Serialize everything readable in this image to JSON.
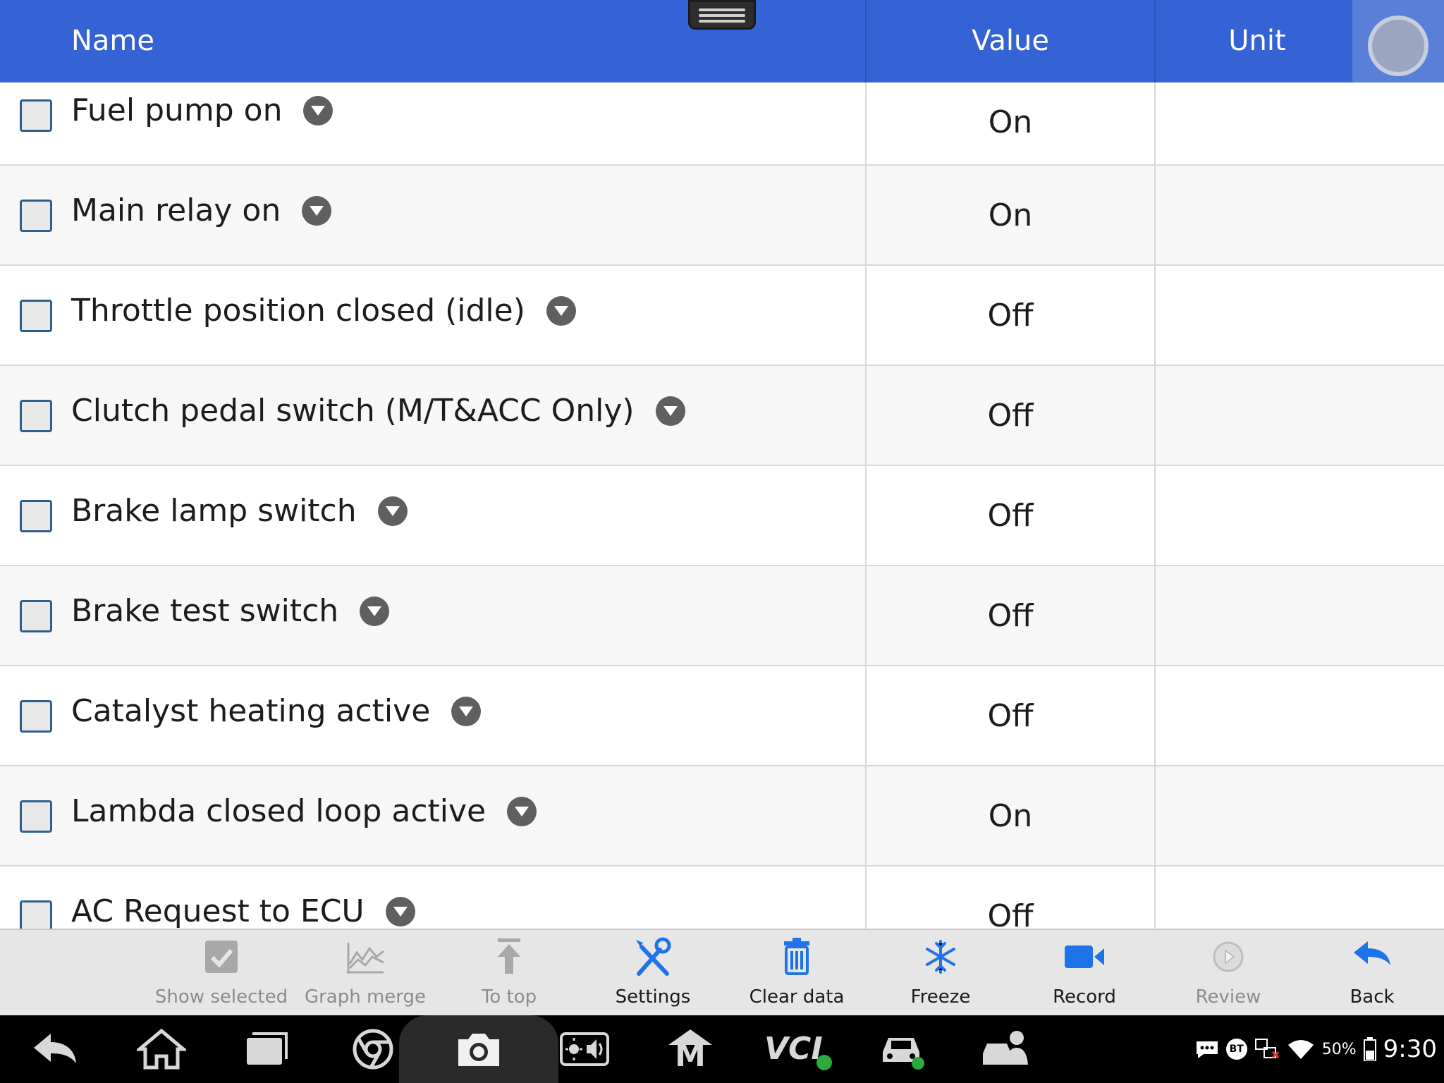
{
  "header": {
    "col_name": "Name",
    "col_value": "Value",
    "col_unit": "Unit"
  },
  "rows": [
    {
      "name": "Fuel pump on",
      "value": "On",
      "unit": ""
    },
    {
      "name": "Main relay on",
      "value": "On",
      "unit": ""
    },
    {
      "name": "Throttle position closed (idle)",
      "value": "Off",
      "unit": ""
    },
    {
      "name": "Clutch pedal switch (M/T&ACC Only)",
      "value": "Off",
      "unit": ""
    },
    {
      "name": "Brake lamp switch",
      "value": "Off",
      "unit": ""
    },
    {
      "name": "Brake test switch",
      "value": "Off",
      "unit": ""
    },
    {
      "name": "Catalyst heating active",
      "value": "Off",
      "unit": ""
    },
    {
      "name": "Lambda closed loop active",
      "value": "On",
      "unit": ""
    },
    {
      "name": "AC Request to ECU",
      "value": "Off",
      "unit": ""
    }
  ],
  "toolbar": {
    "show_selected": "Show selected",
    "graph_merge": "Graph merge",
    "to_top": "To top",
    "settings": "Settings",
    "clear_data": "Clear data",
    "freeze": "Freeze",
    "record": "Record",
    "review": "Review",
    "back": "Back"
  },
  "status": {
    "bt": "BT",
    "battery": "50%",
    "time": "9:30"
  },
  "nav": {
    "vci": "VCI",
    "m": "M"
  },
  "colors": {
    "header": "#3562d4",
    "accent": "#1f73e8",
    "checkbox_border": "#2e5f8f"
  }
}
